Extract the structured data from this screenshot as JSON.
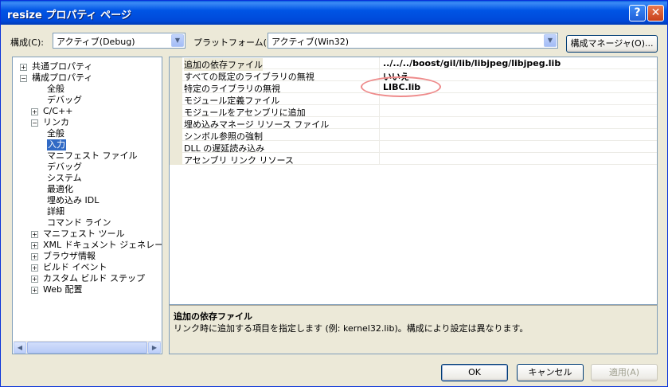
{
  "window": {
    "title": "resize プロパティ ページ"
  },
  "toolbar": {
    "config_label": "構成(C):",
    "config_value": "アクティブ(Debug)",
    "platform_label": "プラットフォーム(P):",
    "platform_value": "アクティブ(Win32)",
    "config_manager_label": "構成マネージャ(O)..."
  },
  "tree": {
    "items": [
      {
        "label": "共通プロパティ",
        "expander": "+"
      },
      {
        "label": "構成プロパティ",
        "expander": "−"
      },
      {
        "label": "全般"
      },
      {
        "label": "デバッグ"
      },
      {
        "label": "C/C++",
        "expander": "+"
      },
      {
        "label": "リンカ",
        "expander": "−"
      },
      {
        "label": "全般"
      },
      {
        "label": "入力",
        "selected": true
      },
      {
        "label": "マニフェスト ファイル"
      },
      {
        "label": "デバッグ"
      },
      {
        "label": "システム"
      },
      {
        "label": "最適化"
      },
      {
        "label": "埋め込み IDL"
      },
      {
        "label": "詳細"
      },
      {
        "label": "コマンド ライン"
      },
      {
        "label": "マニフェスト ツール",
        "expander": "+"
      },
      {
        "label": "XML ドキュメント ジェネレータ",
        "expander": "+"
      },
      {
        "label": "ブラウザ情報",
        "expander": "+"
      },
      {
        "label": "ビルド イベント",
        "expander": "+"
      },
      {
        "label": "カスタム ビルド ステップ",
        "expander": "+"
      },
      {
        "label": "Web 配置",
        "expander": "+"
      }
    ]
  },
  "grid": {
    "rows": [
      {
        "name": "追加の依存ファイル",
        "value": "../../../boost/gil/lib/libjpeg/libjpeg.lib"
      },
      {
        "name": "すべての既定のライブラリの無視",
        "value": "いいえ"
      },
      {
        "name": "特定のライブラリの無視",
        "value": "LIBC.lib"
      },
      {
        "name": "モジュール定義ファイル",
        "value": ""
      },
      {
        "name": "モジュールをアセンブリに追加",
        "value": ""
      },
      {
        "name": "埋め込みマネージ リソース ファイル",
        "value": ""
      },
      {
        "name": "シンボル参照の強制",
        "value": ""
      },
      {
        "name": "DLL の遅延読み込み",
        "value": ""
      },
      {
        "name": "アセンブリ リンク リソース",
        "value": ""
      }
    ]
  },
  "description": {
    "title": "追加の依存ファイル",
    "body": "リンク時に追加する項目を指定します (例: kernel32.lib)。構成により設定は異なります。"
  },
  "buttons": {
    "ok": "OK",
    "cancel": "キャンセル",
    "apply": "適用(A)"
  },
  "colors": {
    "titlebar": "#0055e5",
    "selection": "#316ac5",
    "highlight_ellipse": "#ee8a8a"
  }
}
